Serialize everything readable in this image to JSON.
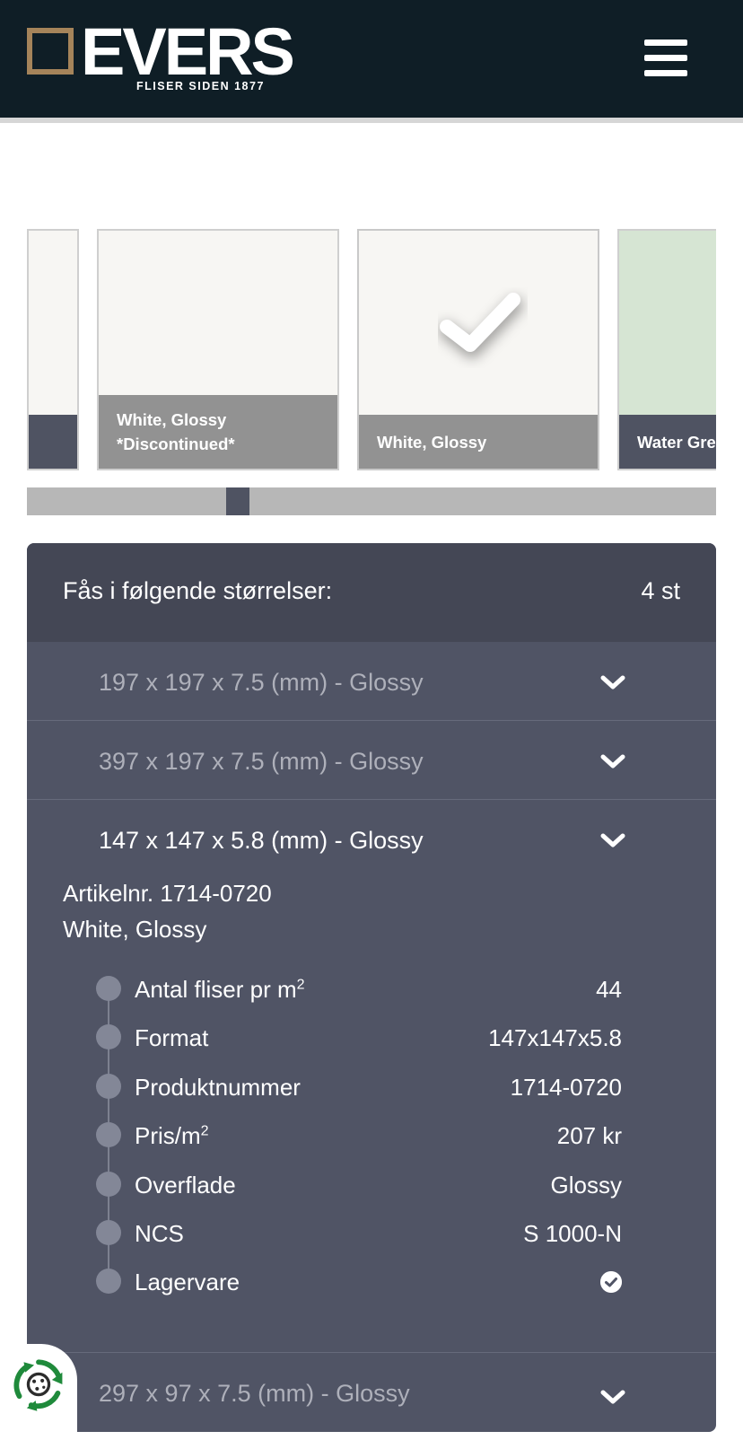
{
  "header": {
    "logo_word": "EVERS",
    "logo_tagline": "FLISER SIDEN 1877",
    "menu_icon": "hamburger-menu-icon",
    "background": "#0f1e26",
    "logo_accent": "#a5845a"
  },
  "swatches": [
    {
      "label": "",
      "color": "#f7f6f3"
    },
    {
      "label_line1": "White, Glossy",
      "label_line2": "*Discontinued*",
      "color": "#f7f6f3"
    },
    {
      "label": "White, Glossy",
      "color": "#f7f6f3",
      "selected": true
    },
    {
      "label": "Water Gre",
      "color": "#d6e5d3"
    }
  ],
  "sizes_panel": {
    "title": "Fås i følgende størrelser:",
    "count": "4 st",
    "rows": [
      {
        "label": "197 x 197 x 7.5 (mm) - Glossy"
      },
      {
        "label": "397 x 197 x 7.5 (mm) - Glossy"
      },
      {
        "label": "147 x 147 x 5.8 (mm) - Glossy",
        "expanded": true
      },
      {
        "label": "297 x 97 x 7.5 (mm) - Glossy"
      }
    ],
    "detail": {
      "article": "Artikelnr. 1714-0720",
      "color_name": "White, Glossy",
      "specs": [
        {
          "key": "Antal fliser pr m",
          "sup": "2",
          "value": "44"
        },
        {
          "key": "Format",
          "value": "147x147x5.8"
        },
        {
          "key": "Produktnummer",
          "value": "1714-0720"
        },
        {
          "key": "Pris/m",
          "sup": "2",
          "value": "207 kr"
        },
        {
          "key": "Overflade",
          "value": "Glossy"
        },
        {
          "key": "NCS",
          "value": "S 1000-N"
        },
        {
          "key": "Lagervare",
          "value_icon": "check-circle-icon"
        }
      ]
    }
  },
  "floating": {
    "recycle_icon": "recycle-icon"
  }
}
